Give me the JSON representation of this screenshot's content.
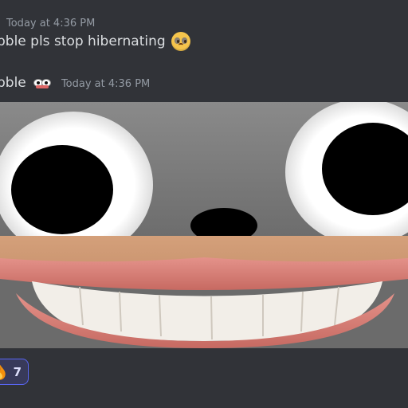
{
  "message1": {
    "timestamp": "Today at 4:36 PM",
    "text": "bble pls stop hibernating",
    "emoji": "pleading-face-emoji"
  },
  "message2": {
    "author": "bble",
    "timestamp": "Today at 4:36 PM",
    "badge_icon": "googly-face-icon"
  },
  "attachment": {
    "type": "image",
    "description_icon": "gray-cartoon-face-with-human-smile"
  },
  "reaction": {
    "emoji": "fire-emoji",
    "count": "7"
  },
  "colors": {
    "background": "#313338",
    "text": "#dbdee1",
    "muted": "#949ba4",
    "reaction_bg": "#383a5a",
    "reaction_border": "#5865f2"
  }
}
